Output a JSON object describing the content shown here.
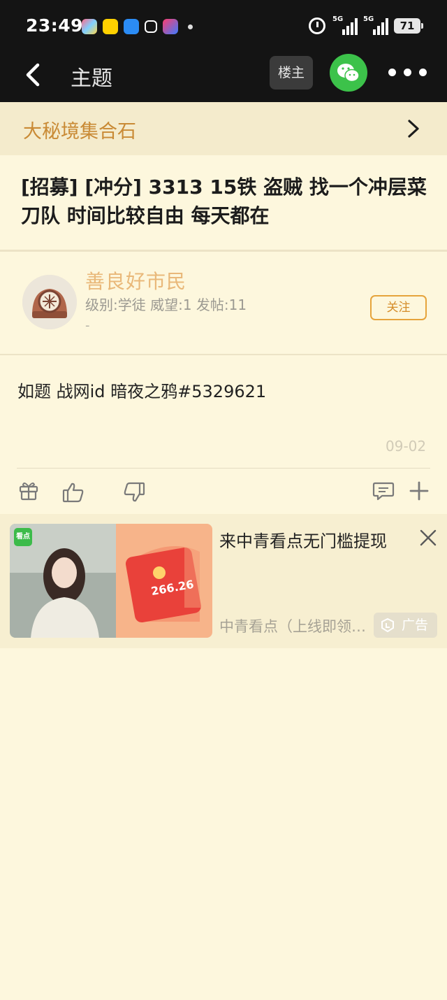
{
  "status_bar": {
    "time": "23:49",
    "signal_1": "5G",
    "signal_2": "5G",
    "battery": "71"
  },
  "nav": {
    "title": "主题",
    "op_label": "楼主"
  },
  "forum": {
    "name": "大秘境集合石"
  },
  "post": {
    "title": "[招募] [冲分] 3313 15铁 盗贼 找一个冲层菜刀队 时间比较自由 每天都在",
    "content": "如题 战网id 暗夜之鸦#5329621",
    "date": "09-02"
  },
  "author": {
    "name": "善良好市民",
    "meta": "级别:学徒 威望:1 发帖:11",
    "extra": "-",
    "follow_label": "关注"
  },
  "ad": {
    "title": "来中青看点无门槛提现",
    "source": "中青看点（上线即领红包）",
    "badge": "广告",
    "image_logo_text": "看点",
    "image_amount": "266.26"
  },
  "colors": {
    "background": "#fdf7dd",
    "top_bar": "#141414",
    "forum_name": "#c98a35",
    "author_name": "#e9b879",
    "follow_border": "#e6a43c",
    "wechat_green": "#3cc24a"
  }
}
